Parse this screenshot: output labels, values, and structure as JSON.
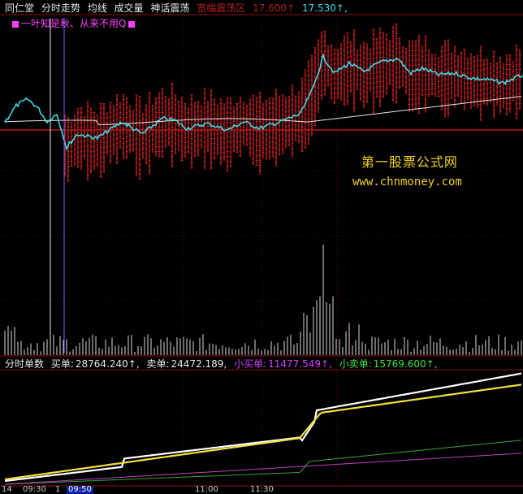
{
  "header": {
    "stock_name": "同仁堂",
    "menu": [
      "分时走势",
      "均线",
      "成交量",
      "神话震荡"
    ],
    "indicator_label": "宽幅震荡区",
    "indicator_value1": "17.600↑",
    "indicator_value2": "17.530↑,"
  },
  "legend": {
    "text": "一叶知是秋、从来不用Q"
  },
  "watermark": {
    "title": "第一股票公式网",
    "url": "www.chnmoney.com"
  },
  "lower_panel": {
    "title": "分时单数",
    "buy_label": "买单:",
    "buy_value": "28764.240↑,",
    "sell_label": "卖单:",
    "sell_value": "24472.189,",
    "small_buy_label": "小买单:",
    "small_buy_value": "11477.549↑,",
    "small_sell_label": "小卖单:",
    "small_sell_value": "15769.600↑,"
  },
  "time_axis": {
    "labels": [
      "14",
      "09:30",
      "1",
      "09:50",
      "11:00",
      "11:30"
    ]
  },
  "colors": {
    "price_line": "#40d8e8",
    "avg_line": "#e8e8e8",
    "band_red": "#a01818",
    "volume_bar": "#d8d8d8",
    "buy_line": "#ffffff",
    "sell_line": "#f0e040",
    "small_buy_line": "#c040c0",
    "small_sell_line": "#40a040"
  }
}
